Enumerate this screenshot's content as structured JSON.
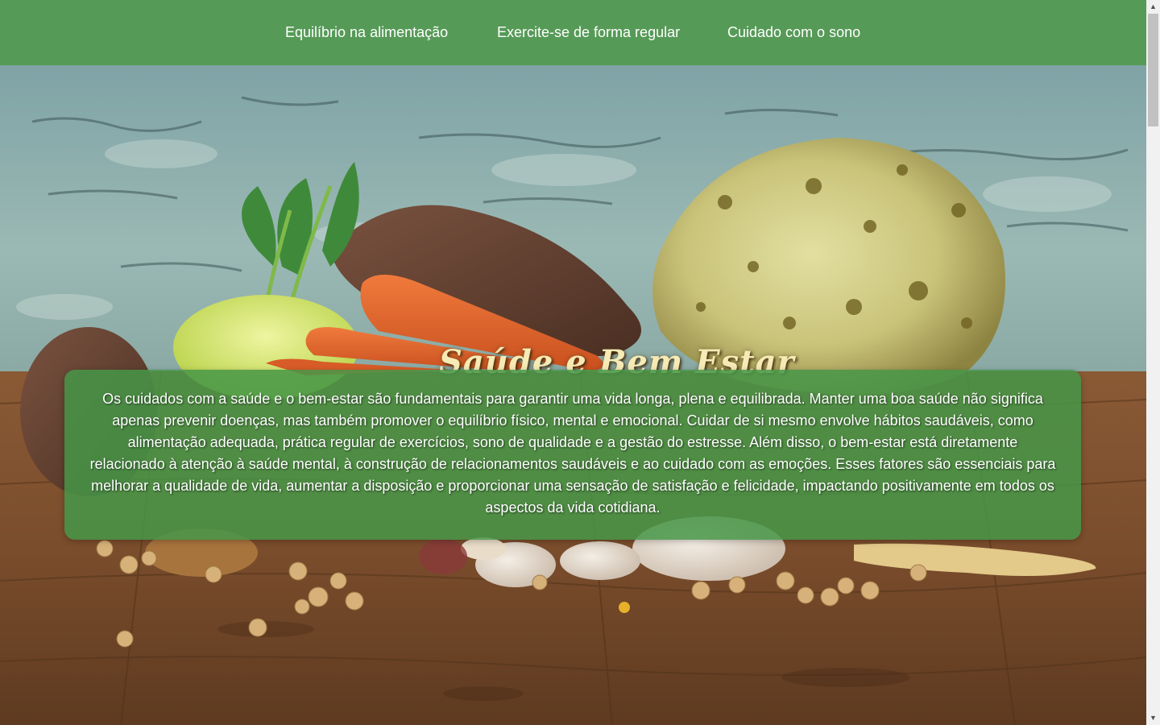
{
  "nav": {
    "items": [
      {
        "label": "Equilíbrio na alimentação"
      },
      {
        "label": "Exercite-se de forma regular"
      },
      {
        "label": "Cuidado com o sono"
      }
    ]
  },
  "hero": {
    "title": "Saúde e Bem Estar",
    "paragraph": "Os cuidados com a saúde e o bem-estar são fundamentais para garantir uma vida longa, plena e equilibrada. Manter uma boa saúde não significa apenas prevenir doenças, mas também promover o equilíbrio físico, mental e emocional. Cuidar de si mesmo envolve hábitos saudáveis, como alimentação adequada, prática regular de exercícios, sono de qualidade e a gestão do estresse. Além disso, o bem-estar está diretamente relacionado à atenção à saúde mental, à construção de relacionamentos saudáveis e ao cuidado com as emoções. Esses fatores são essenciais para melhorar a qualidade de vida, aumentar a disposição e proporcionar uma sensação de satisfação e felicidade, impactando positivamente em todos os aspectos da vida cotidiana."
  },
  "colors": {
    "nav_background": "#569a57",
    "card_background": "#46964880",
    "title_color": "#f6eab5"
  },
  "icons": {
    "scroll_up": "scroll-up-arrow-icon",
    "scroll_down": "scroll-down-arrow-icon"
  }
}
